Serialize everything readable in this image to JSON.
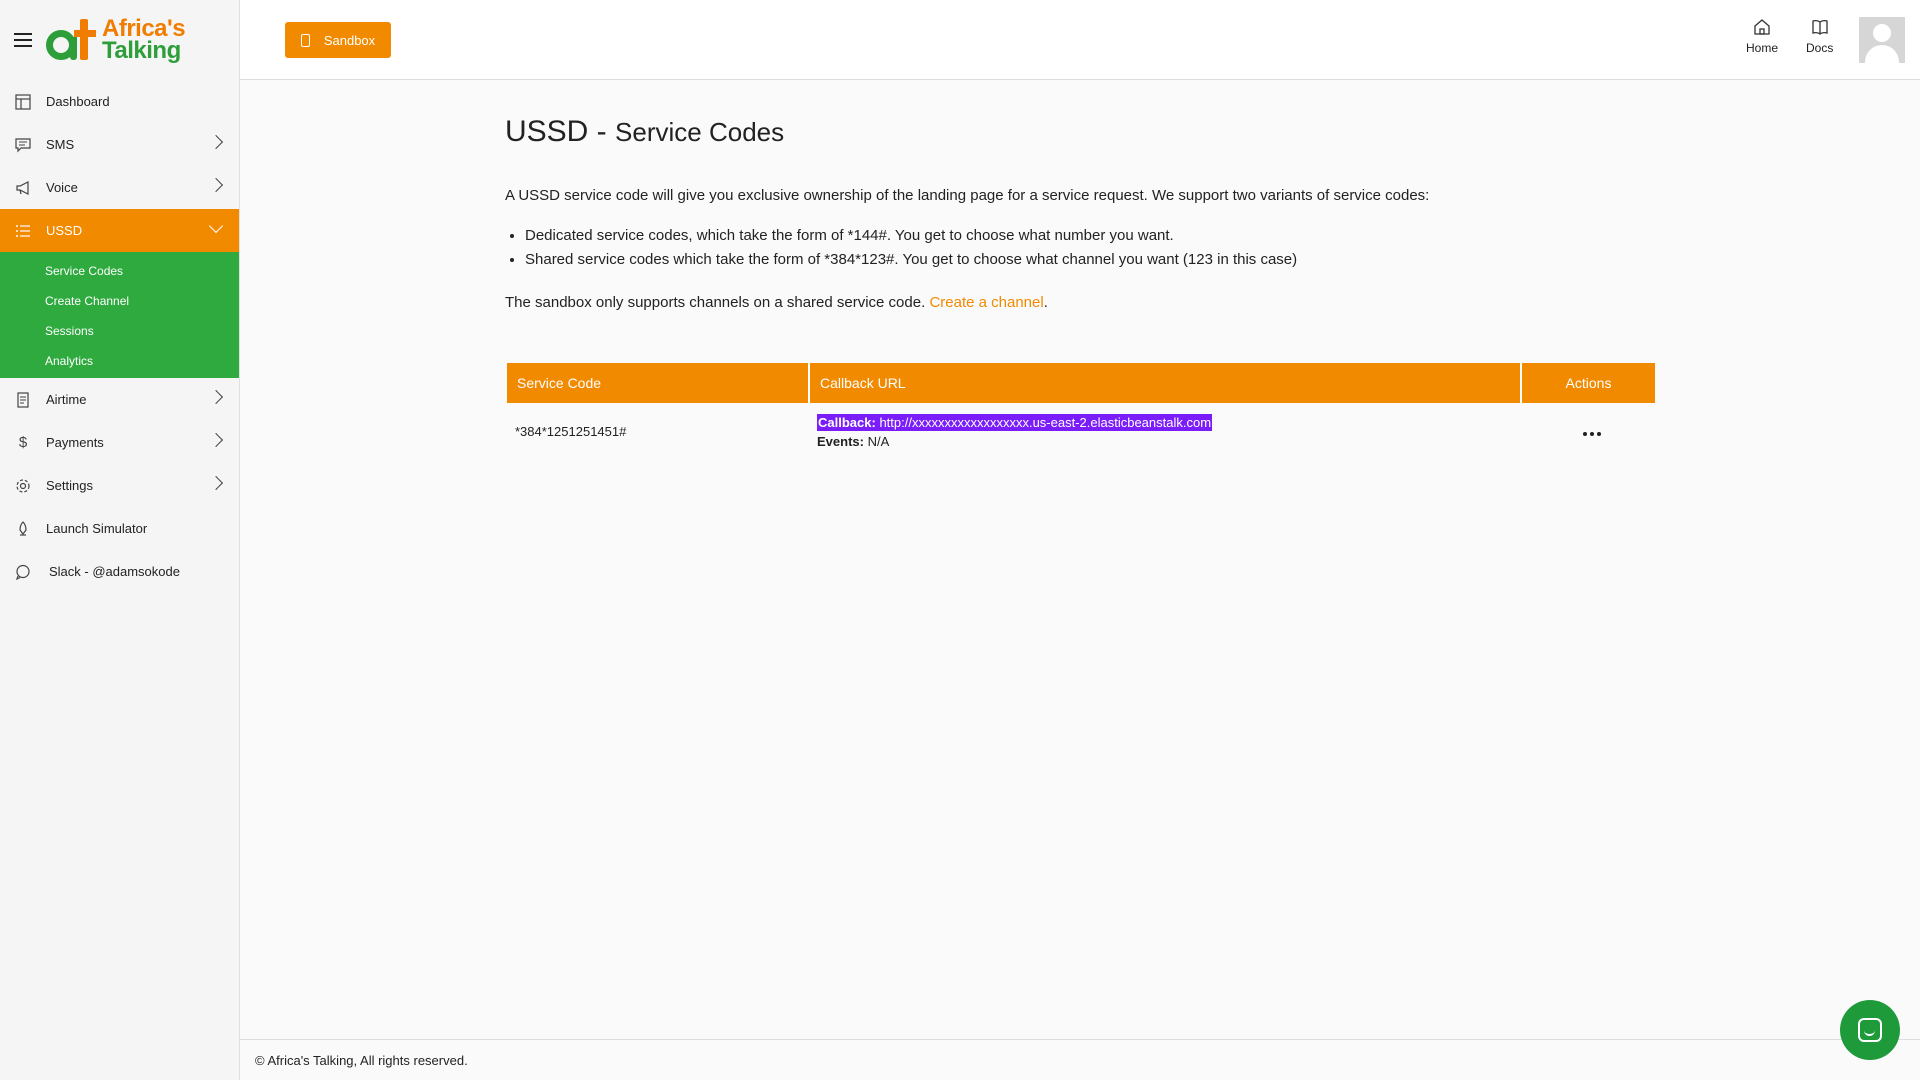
{
  "brand": {
    "line1": "Africa's",
    "line2": "Talking"
  },
  "sidebar": {
    "items": [
      {
        "label": "Dashboard",
        "icon": "dashboard-icon",
        "chevron": false
      },
      {
        "label": "SMS",
        "icon": "message-icon",
        "chevron": true
      },
      {
        "label": "Voice",
        "icon": "megaphone-icon",
        "chevron": true
      },
      {
        "label": "USSD",
        "icon": "list-icon",
        "chevron": true,
        "active": true
      },
      {
        "label": "Airtime",
        "icon": "receipt-icon",
        "chevron": true
      },
      {
        "label": "Payments",
        "icon": "dollar-icon",
        "chevron": true
      },
      {
        "label": "Settings",
        "icon": "gear-icon",
        "chevron": true
      },
      {
        "label": "Launch Simulator",
        "icon": "rocket-icon",
        "chevron": false
      },
      {
        "label": "Slack - @adamsokode",
        "icon": "chat-icon",
        "chevron": false
      }
    ],
    "ussd_sub": [
      "Service Codes",
      "Create Channel",
      "Sessions",
      "Analytics"
    ]
  },
  "header": {
    "sandbox_label": "Sandbox",
    "home_label": "Home",
    "docs_label": "Docs"
  },
  "main": {
    "title": "USSD -",
    "title_sub": "Service Codes",
    "intro": "A USSD service code will give you exclusive ownership of the landing page for a service request. We support two variants of service codes:",
    "bullets": [
      "Dedicated service codes, which take the form of *144#. You get to choose what number you want.",
      "Shared service codes which take the form of *384*123#. You get to choose what channel you want (123 in this case)"
    ],
    "note": "The sandbox only supports channels on a shared service code.",
    "note_link": "Create a channel",
    "note_end": ".",
    "table": {
      "headers": [
        "Service Code",
        "Callback URL",
        "Actions"
      ],
      "rows": [
        {
          "code": "*384*1251251451#",
          "callback_label": "Callback:",
          "callback_url": "http://xxxxxxxxxxxxxxxxxx.us-east-2.elasticbeanstalk.com",
          "events_label": "Events:",
          "events_value": "N/A"
        }
      ]
    }
  },
  "footer": {
    "text": "© Africa's Talking, All rights reserved."
  },
  "colors": {
    "accent": "#f28a00",
    "green": "#2eaa3f",
    "selection": "#7b1dfa"
  }
}
